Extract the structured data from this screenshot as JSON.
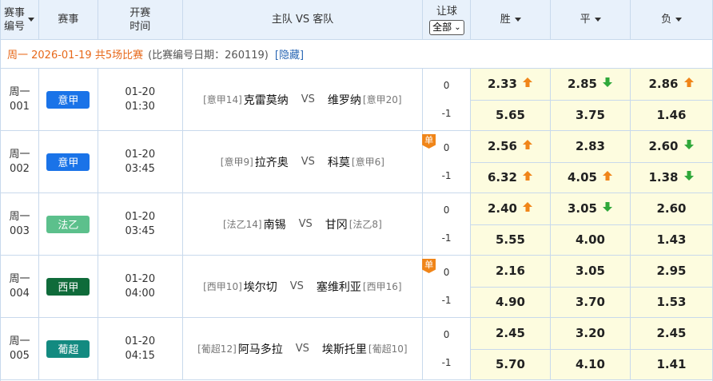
{
  "header": {
    "col_match_no": [
      "赛事",
      "编号"
    ],
    "col_league": "赛事",
    "col_time": [
      "开赛",
      "时间"
    ],
    "col_teams": "主队 VS 客队",
    "col_handicap": "让球",
    "handicap_select": "全部",
    "col_win": "胜",
    "col_draw": "平",
    "col_lose": "负"
  },
  "info": {
    "date_text": "周一 2026-01-19 共5场比赛",
    "range_text": "(比赛编号日期：260119)",
    "hide_text": "[隐藏]"
  },
  "matches": [
    {
      "no_day": "周一",
      "no_num": "001",
      "league": "意甲",
      "league_color": "#1a73e8",
      "date": "01-20",
      "time": "01:30",
      "home_rank": "[意甲14]",
      "home": "克雷莫纳",
      "vs": "VS",
      "away": "维罗纳",
      "away_rank": "[意甲20]",
      "single": "",
      "hc1": "0",
      "hc2": "-1",
      "odds1": [
        {
          "v": "2.33",
          "t": "up"
        },
        {
          "v": "2.85",
          "t": "down"
        },
        {
          "v": "2.86",
          "t": "up"
        }
      ],
      "odds2": [
        {
          "v": "5.65",
          "t": ""
        },
        {
          "v": "3.75",
          "t": ""
        },
        {
          "v": "1.46",
          "t": ""
        }
      ]
    },
    {
      "no_day": "周一",
      "no_num": "002",
      "league": "意甲",
      "league_color": "#1a73e8",
      "date": "01-20",
      "time": "03:45",
      "home_rank": "[意甲9]",
      "home": "拉齐奥",
      "vs": "VS",
      "away": "科莫",
      "away_rank": "[意甲6]",
      "single": "单",
      "hc1": "0",
      "hc2": "-1",
      "odds1": [
        {
          "v": "2.56",
          "t": "up"
        },
        {
          "v": "2.83",
          "t": ""
        },
        {
          "v": "2.60",
          "t": "down"
        }
      ],
      "odds2": [
        {
          "v": "6.32",
          "t": "up"
        },
        {
          "v": "4.05",
          "t": "up"
        },
        {
          "v": "1.38",
          "t": "down"
        }
      ]
    },
    {
      "no_day": "周一",
      "no_num": "003",
      "league": "法乙",
      "league_color": "#5cc08c",
      "date": "01-20",
      "time": "03:45",
      "home_rank": "[法乙14]",
      "home": "南锡",
      "vs": "VS",
      "away": "甘冈",
      "away_rank": "[法乙8]",
      "single": "",
      "hc1": "0",
      "hc2": "-1",
      "odds1": [
        {
          "v": "2.40",
          "t": "up"
        },
        {
          "v": "3.05",
          "t": "down"
        },
        {
          "v": "2.60",
          "t": ""
        }
      ],
      "odds2": [
        {
          "v": "5.55",
          "t": ""
        },
        {
          "v": "4.00",
          "t": ""
        },
        {
          "v": "1.43",
          "t": ""
        }
      ]
    },
    {
      "no_day": "周一",
      "no_num": "004",
      "league": "西甲",
      "league_color": "#0f6b3a",
      "date": "01-20",
      "time": "04:00",
      "home_rank": "[西甲10]",
      "home": "埃尔切",
      "vs": "VS",
      "away": "塞维利亚",
      "away_rank": "[西甲16]",
      "single": "单",
      "hc1": "0",
      "hc2": "-1",
      "odds1": [
        {
          "v": "2.16",
          "t": ""
        },
        {
          "v": "3.05",
          "t": ""
        },
        {
          "v": "2.95",
          "t": ""
        }
      ],
      "odds2": [
        {
          "v": "4.90",
          "t": ""
        },
        {
          "v": "3.70",
          "t": ""
        },
        {
          "v": "1.53",
          "t": ""
        }
      ]
    },
    {
      "no_day": "周一",
      "no_num": "005",
      "league": "葡超",
      "league_color": "#138a80",
      "date": "01-20",
      "time": "04:15",
      "home_rank": "[葡超12]",
      "home": "阿马多拉",
      "vs": "VS",
      "away": "埃斯托里",
      "away_rank": "[葡超10]",
      "single": "",
      "hc1": "0",
      "hc2": "-1",
      "odds1": [
        {
          "v": "2.45",
          "t": ""
        },
        {
          "v": "3.20",
          "t": ""
        },
        {
          "v": "2.45",
          "t": ""
        }
      ],
      "odds2": [
        {
          "v": "5.70",
          "t": ""
        },
        {
          "v": "4.10",
          "t": ""
        },
        {
          "v": "1.41",
          "t": ""
        }
      ]
    }
  ],
  "colors": {
    "up": "#f08519",
    "down": "#2fa83a",
    "odds_bg": "#fdfcdf",
    "header_bg": "#e8f1fb"
  }
}
